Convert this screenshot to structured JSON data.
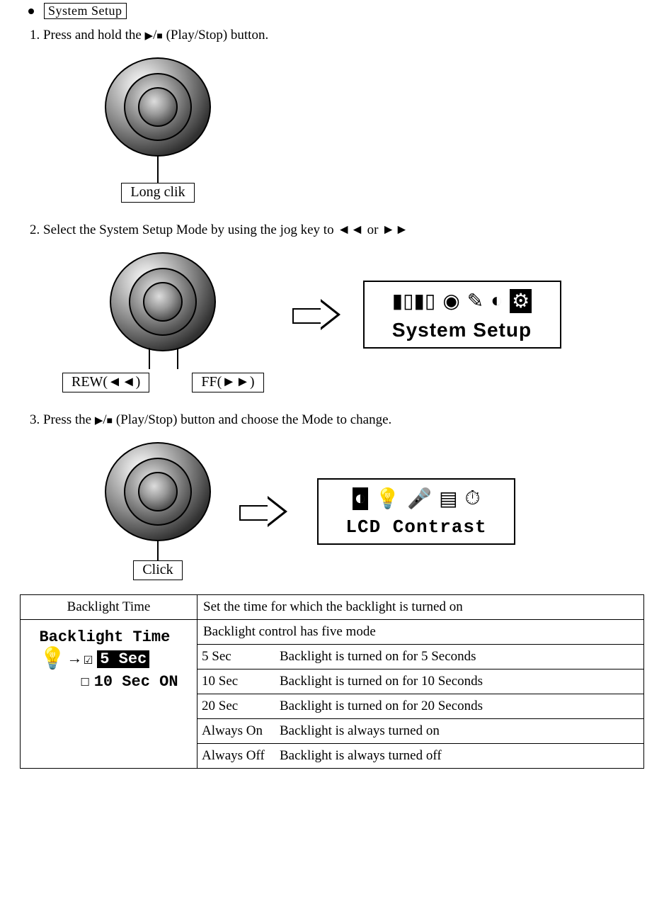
{
  "section_title": "System Setup",
  "steps": {
    "1": {
      "num": "1.",
      "text_a": "Press and hold the ",
      "text_b": " (Play/Stop) button."
    },
    "2": {
      "num": "2.",
      "text": "Select the System Setup Mode by using the jog key to ◄◄ or ►►"
    },
    "3": {
      "num": "3.",
      "text_a": "Press the ",
      "text_b": " (Play/Stop) button and choose the Mode to change."
    }
  },
  "labels": {
    "long_click": "Long clik",
    "rew": "REW(◄◄)",
    "ff": "FF(►►)",
    "click": "Click",
    "play_stop": "▶/■"
  },
  "lcd": {
    "system_setup": "System Setup",
    "lcd_contrast": "LCD Contrast"
  },
  "table": {
    "header": "Backlight Time",
    "header_desc": "Set the time for which the backlight is turned on",
    "sub_header": "Backlight control has five mode",
    "modes": [
      {
        "label": "5 Sec",
        "desc": "Backlight is turned on for 5 Seconds"
      },
      {
        "label": "10 Sec",
        "desc": "Backlight is turned on for 10 Seconds"
      },
      {
        "label": "20 Sec",
        "desc": "Backlight is turned on for 20 Seconds"
      },
      {
        "label": "Always On",
        "desc": "Backlight is always turned on"
      },
      {
        "label": "Always Off",
        "desc": "Backlight is always turned off"
      }
    ],
    "screen": {
      "title": "Backlight Time",
      "sel": "5 Sec",
      "next": "10 Sec ON"
    }
  }
}
